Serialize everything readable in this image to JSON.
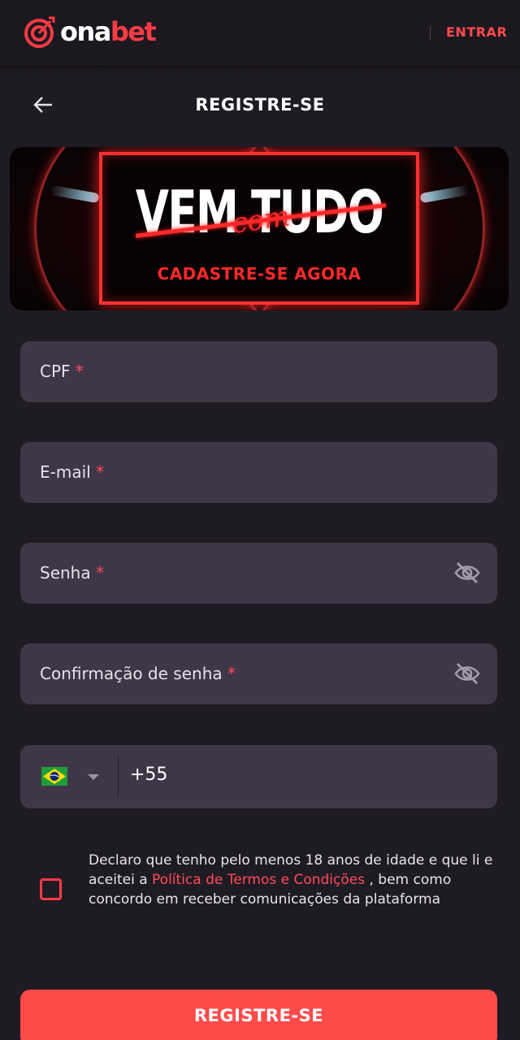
{
  "header": {
    "logo_part1": "ona",
    "logo_part2": "bet",
    "login_label": "ENTRAR"
  },
  "page": {
    "title": "REGISTRE-SE",
    "back_icon": "arrow-left-icon"
  },
  "banner": {
    "headline": "VEM TUDO",
    "script_word": "com",
    "subtitle": "CADASTRE-SE AGORA"
  },
  "form": {
    "cpf_label": "CPF",
    "email_label": "E-mail",
    "password_label": "Senha",
    "password_confirm_label": "Confirmação de senha",
    "required_mark": "*",
    "password_toggle_icon": "eye-off-icon",
    "phone": {
      "country_flag": "brazil-flag-icon",
      "dial_code": "+55"
    },
    "terms": {
      "text_before": "Declaro que tenho pelo menos 18 anos de idade e que li e aceitei a",
      "link": "Política de Termos e Condições",
      "text_after": ", bem como concordo em receber comunicações da plataforma",
      "checked": false
    },
    "submit_label": "REGISTRE-SE"
  },
  "colors": {
    "accent": "#ff4a4a",
    "background": "#1f1b24",
    "field_bg": "#3f3747",
    "required": "#ff4b57"
  }
}
